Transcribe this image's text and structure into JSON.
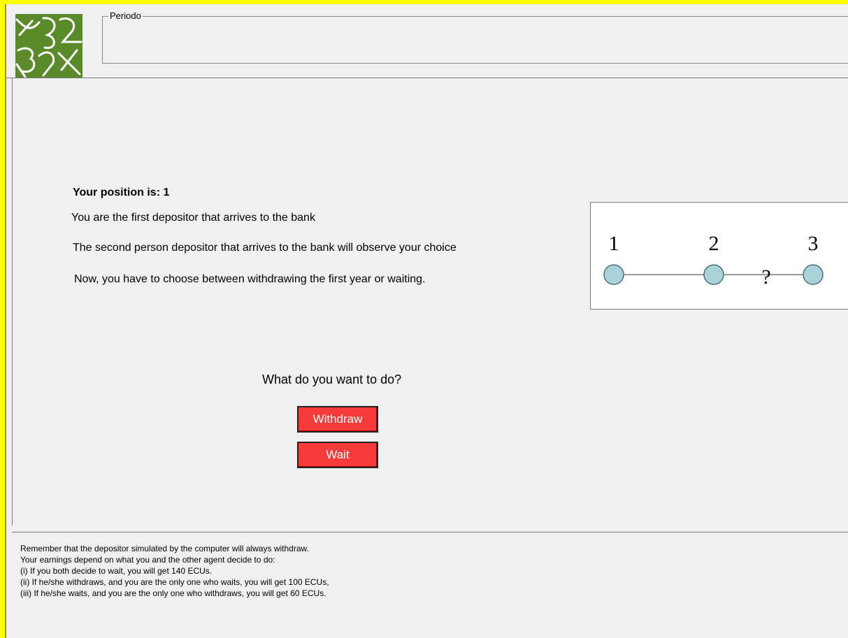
{
  "header": {
    "period_label": "Periodo",
    "logo_icon": "green-pattern-logo-icon"
  },
  "main": {
    "position_title": "Your position is: 1",
    "lines": [
      "You are the first depositor that arrives to the bank",
      "The second person depositor that  arrives to the bank will observe your choice",
      "Now, you have to choose between withdrawing the first year or waiting."
    ],
    "question": "What do you want to do?",
    "buttons": {
      "withdraw_label": "Withdraw",
      "wait_label": "Wait"
    },
    "diagram": {
      "positions": [
        "1",
        "2",
        "3"
      ],
      "unknown_marker": "?"
    }
  },
  "footer": {
    "lines": [
      "Remember that the depositor simulated by the computer will always withdraw.",
      "Your earnings depend on what you and the other agent decide to do:",
      "(i) If you both decide to wait, you will get 140 ECUs.",
      "(ii) If he/she withdraws, and you are the only one who waits, you will get 100 ECUs,",
      "(iii) If he/she waits, and you are the only one who withdraws, you will get 60 ECUs."
    ]
  },
  "colors": {
    "frame": "#ffff00",
    "button": "#f73b3b",
    "node": "#a9d3d8",
    "logo_bg": "#5b8a2a"
  }
}
